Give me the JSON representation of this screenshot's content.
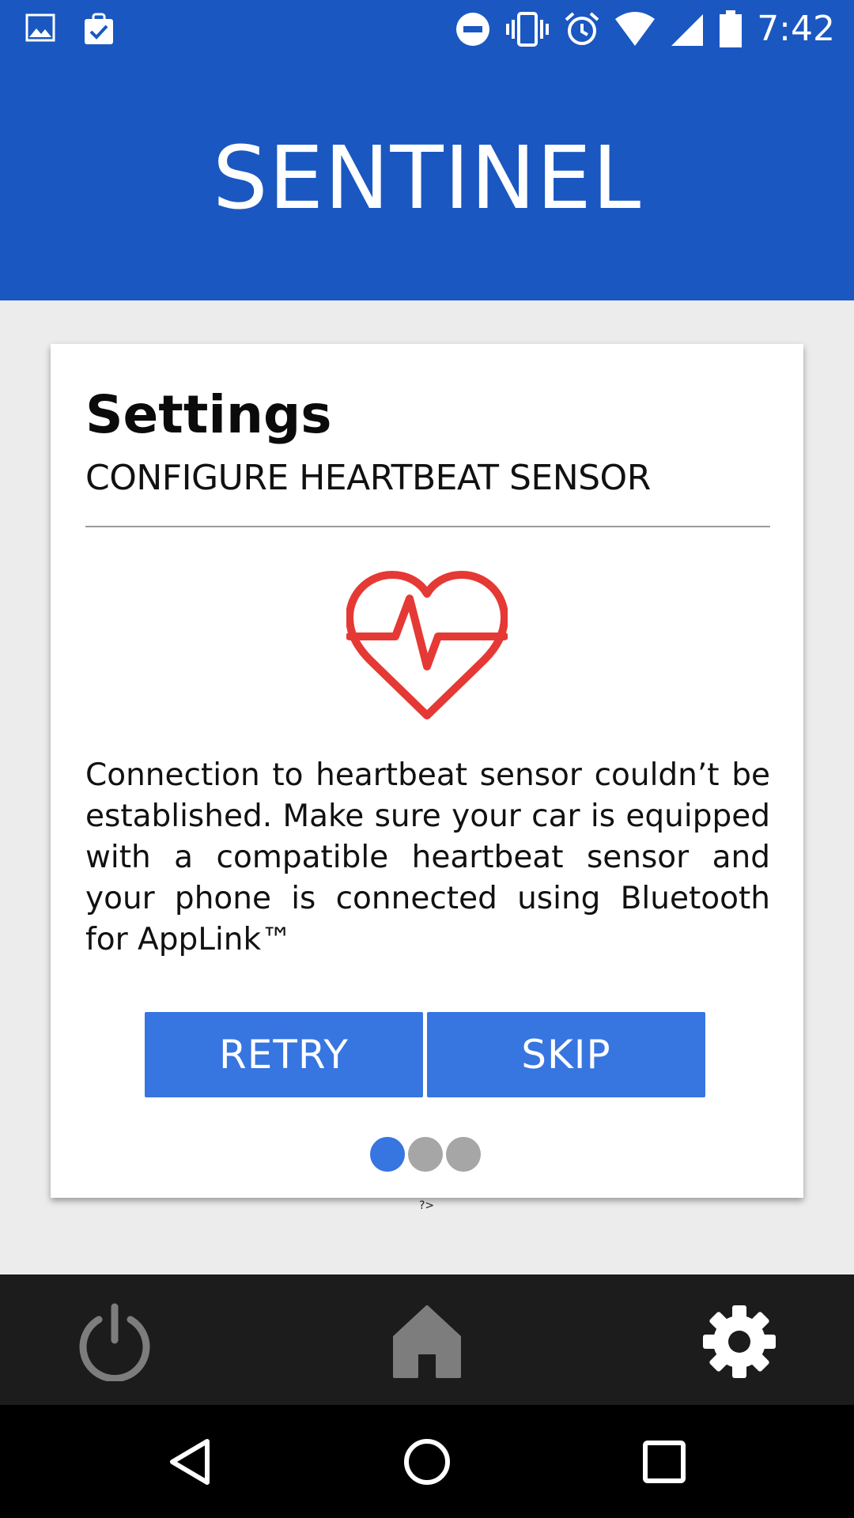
{
  "status_bar": {
    "time": "7:42",
    "left_icons": [
      "image-icon",
      "clipboard-check-icon"
    ],
    "right_icons": [
      "do-not-disturb-icon",
      "vibrate-icon",
      "alarm-icon",
      "wifi-icon",
      "signal-icon",
      "battery-icon"
    ]
  },
  "header": {
    "title": "SENTINEL"
  },
  "card": {
    "title": "Settings",
    "subtitle": "CONFIGURE HEARTBEAT SENSOR",
    "icon": "heartbeat-icon",
    "message": "Connection to heartbeat sensor couldn’t be established. Make sure your car is equipped with a compatible heartbeat sensor and your phone is connected using Bluetooth for AppLink™",
    "retry_label": "RETRY",
    "skip_label": "SKIP",
    "pager": {
      "total": 3,
      "active": 1
    }
  },
  "stray_text": "?>",
  "tabbar": {
    "items": [
      {
        "name": "power",
        "icon": "power-icon"
      },
      {
        "name": "home",
        "icon": "home-icon"
      },
      {
        "name": "settings",
        "icon": "gear-icon"
      }
    ]
  },
  "nav": {
    "items": [
      "back",
      "home",
      "recents"
    ]
  },
  "colors": {
    "primary": "#1a57c1",
    "button": "#3775e0",
    "heart": "#e53935",
    "tabbar": "#1c1c1c"
  }
}
